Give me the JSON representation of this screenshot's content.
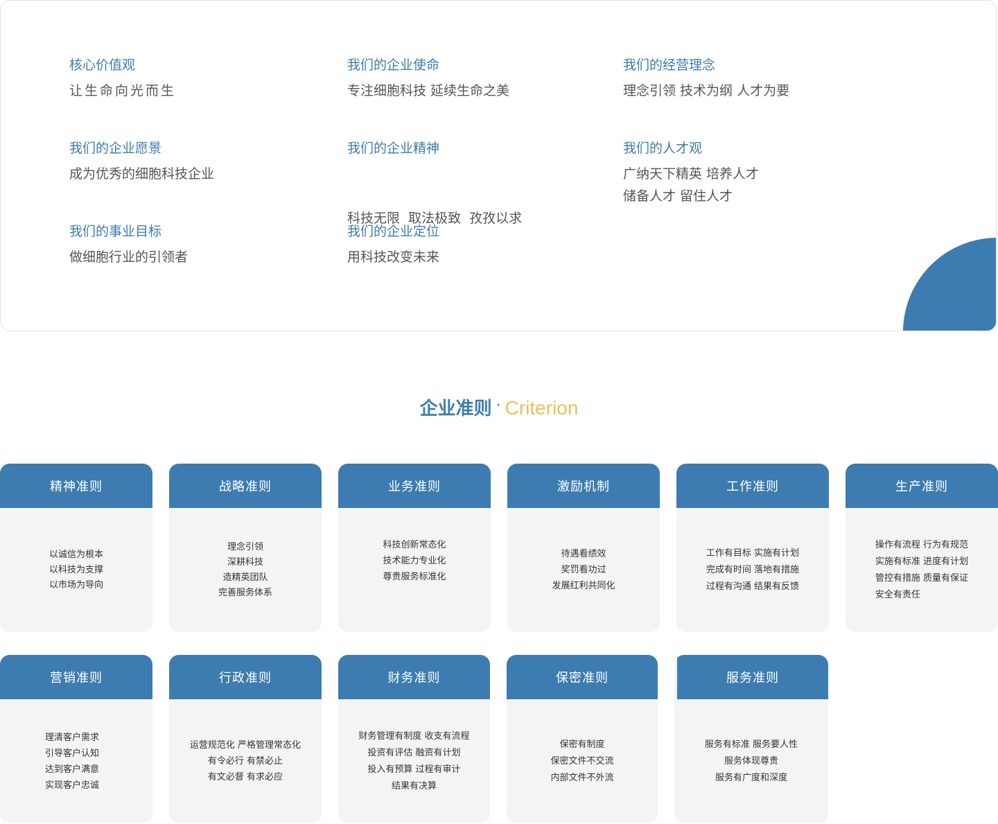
{
  "values": [
    {
      "title": "核心价值观",
      "lines": [
        "让生命向光而生"
      ]
    },
    {
      "title": "我们的企业使命",
      "lines": [
        "专注细胞科技 延续生命之美"
      ]
    },
    {
      "title": "我们的经营理念",
      "lines": [
        "理念引领 技术为纲 人才为要"
      ]
    },
    {
      "title": "我们的企业愿景",
      "lines": [
        "成为优秀的细胞科技企业"
      ]
    },
    {
      "title": "我们的企业精神",
      "lines": [
        "科技无限  取法极致  孜孜以求"
      ]
    },
    {
      "title": "我们的人才观",
      "lines": [
        "广纳天下精英 培养人才",
        "储备人才 留住人才"
      ]
    },
    {
      "title": "我们的事业目标",
      "lines": [
        "做细胞行业的引领者"
      ]
    },
    {
      "title": "我们的企业定位",
      "lines": [
        "用科技改变未来"
      ]
    }
  ],
  "criterion": {
    "title_cn": "企业准则",
    "title_dot": "·",
    "title_en": "Criterion"
  },
  "cards": [
    {
      "title": "精神准则",
      "lines": [
        "以诚信为根本",
        "以科技为支撑",
        "以市场为导向"
      ]
    },
    {
      "title": "战略准则",
      "lines": [
        "理念引领",
        "深耕科技",
        "造精英团队",
        "完善服务体系"
      ]
    },
    {
      "title": "业务准则",
      "lines": [
        "科技创新常态化",
        "技术能力专业化",
        "尊贵服务标准化"
      ]
    },
    {
      "title": "激励机制",
      "lines": [
        "待遇看绩效",
        "奖罚看功过",
        "发展红利共同化"
      ]
    },
    {
      "title": "工作准则",
      "lines": [
        "工作有目标 实施有计划",
        "完成有时间 落地有措施",
        "过程有沟通 结果有反馈"
      ]
    },
    {
      "title": "生产准则",
      "lines": [
        "操作有流程 行为有规范",
        "实施有标准 进度有计划",
        "管控有措施 质量有保证",
        "安全有责任"
      ]
    },
    {
      "title": "营销准则",
      "lines": [
        "理清客户需求",
        "引导客户认知",
        "达到客户满意",
        "实现客户忠诚"
      ]
    },
    {
      "title": "行政准则",
      "lines": [
        "运营规范化 严格管理常态化",
        "有令必行 有禁必止",
        "有文必督 有求必应"
      ]
    },
    {
      "title": "财务准则",
      "lines": [
        "财务管理有制度 收支有流程",
        "投资有评估 融资有计划",
        "投入有预算 过程有审计",
        "结果有决算"
      ]
    },
    {
      "title": "保密准则",
      "lines": [
        "保密有制度",
        "保密文件不交流",
        "内部文件不外流"
      ]
    },
    {
      "title": "服务准则",
      "lines": [
        "服务有标准 服务要人性",
        "服务体现尊贵",
        "服务有广度和深度"
      ]
    }
  ]
}
